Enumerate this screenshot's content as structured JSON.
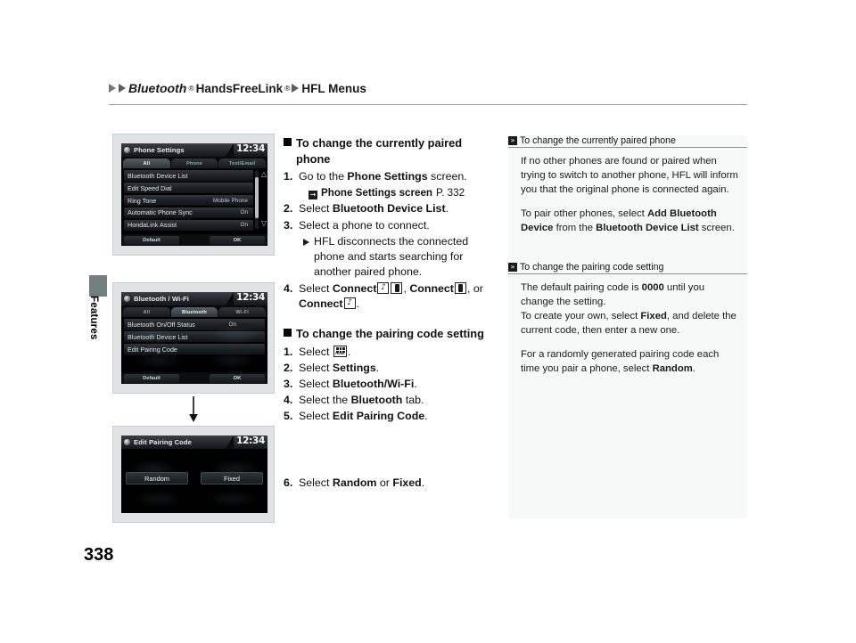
{
  "header": {
    "bluetooth": "Bluetooth",
    "sup": "®",
    "handsfree": " HandsFreeLink",
    "sup2": "®",
    "hfl_menus": "HFL Menus"
  },
  "side_tab": {
    "label": "Features"
  },
  "page_number": "338",
  "screens": [
    {
      "title": "Phone Settings",
      "clock": "12:34",
      "tabs": [
        "All",
        "Phone",
        "Text/Email"
      ],
      "active_tab_index": 0,
      "rows": [
        {
          "label": "Bluetooth Device List",
          "value": ""
        },
        {
          "label": "Edit Speed Dial",
          "value": ""
        },
        {
          "label": "Ring Tone",
          "value": "Mobile Phone"
        },
        {
          "label": "Automatic Phone Sync",
          "value": "On"
        },
        {
          "label": "HondaLink Assist",
          "value": "On"
        }
      ],
      "footer_left": "Default",
      "footer_right": "OK",
      "scroll_up_icon": "chevron-up",
      "scroll_down_icon": "chevron-down"
    },
    {
      "title": "Bluetooth / Wi-Fi",
      "clock": "12:34",
      "tabs": [
        "All",
        "Bluetooth",
        "Wi-Fi"
      ],
      "active_tab_index": 1,
      "rows": [
        {
          "label": "Bluetooth On/Off Status",
          "value": "On"
        },
        {
          "label": "Bluetooth Device List",
          "value": ""
        },
        {
          "label": "Edit Pairing Code",
          "value": ""
        }
      ],
      "footer_left": "Default",
      "footer_right": "OK"
    },
    {
      "title": "Edit Pairing Code",
      "clock": "12:34",
      "choices": [
        "Random",
        "Fixed"
      ]
    }
  ],
  "instructions": [
    {
      "heading": "To change the currently paired phone",
      "steps": [
        {
          "n": "1.",
          "pre": "Go to the ",
          "bold": "Phone Settings",
          "post": " screen."
        },
        {
          "n": "2.",
          "pre": "Select ",
          "bold": "Bluetooth Device List",
          "post": "."
        },
        {
          "n": "3.",
          "pre": "Select a phone to connect.",
          "bold": "",
          "post": ""
        }
      ],
      "xref": {
        "label": "Phone Settings screen",
        "page": "P. 332"
      },
      "sub_note": "HFL disconnects the connected phone and starts searching for another paired phone.",
      "step4": {
        "n": "4.",
        "pre": "Select ",
        "connect1": "Connect",
        "sep1": ", ",
        "connect2": "Connect",
        "sep2": ", or",
        "connect3": "Connect",
        "end": "."
      }
    },
    {
      "heading": "To change the pairing code setting",
      "steps": [
        {
          "n": "1.",
          "pre": "Select ",
          "bold": "",
          "post": ".",
          "icon": "home-icon"
        },
        {
          "n": "2.",
          "pre": "Select ",
          "bold": "Settings",
          "post": "."
        },
        {
          "n": "3.",
          "pre": "Select ",
          "bold": "Bluetooth/Wi-Fi",
          "post": "."
        },
        {
          "n": "4.",
          "pre": "Select the ",
          "bold": "Bluetooth",
          "post": " tab."
        },
        {
          "n": "5.",
          "pre": "Select ",
          "bold": "Edit Pairing Code",
          "post": "."
        }
      ],
      "step6": {
        "n": "6.",
        "pre": "Select ",
        "bold1": "Random",
        "mid": " or ",
        "bold2": "Fixed",
        "post": "."
      }
    }
  ],
  "sidebar": [
    {
      "heading": "To change the currently paired phone",
      "paragraphs": [
        {
          "text": "If no other phones are found or paired when trying to switch to another phone, HFL will inform you that the original phone is connected again."
        },
        {
          "pre": "To pair other phones, select ",
          "bold1": "Add Bluetooth Device",
          "mid": " from the ",
          "bold2": "Bluetooth Device List",
          "post": " screen."
        }
      ]
    },
    {
      "heading": "To change the pairing code setting",
      "paragraphs": [
        {
          "pre": "The default pairing code is ",
          "bold1": "0000",
          "mid": " until you change the setting.",
          "post": ""
        },
        {
          "pre": "To create your own, select ",
          "bold1": "Fixed",
          "mid": ", and delete the current code, then enter a new one.",
          "post": ""
        },
        {
          "pre": "For a randomly generated pairing code each time you pair a phone, select ",
          "bold1": "Random",
          "mid": ".",
          "post": ""
        }
      ]
    }
  ],
  "colors": {
    "tab": "#6f807e",
    "rule": "#9b9b9b",
    "sidebar_bg": "#f7f9f9",
    "frame_bg": "#dfe3e4"
  }
}
